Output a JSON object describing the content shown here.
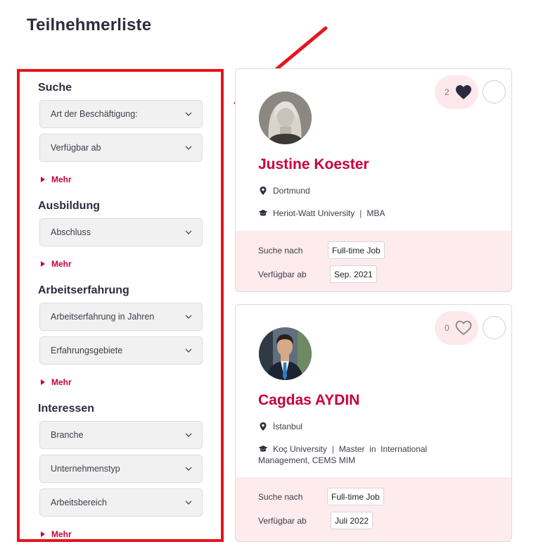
{
  "page": {
    "title": "Teilnehmerliste"
  },
  "filters": {
    "sections": [
      {
        "title": "Suche",
        "selects": [
          "Art der Beschäftigung:",
          "Verfügbar ab"
        ],
        "more_label": "Mehr"
      },
      {
        "title": "Ausbildung",
        "selects": [
          "Abschluss"
        ],
        "more_label": "Mehr"
      },
      {
        "title": "Arbeitserfahrung",
        "selects": [
          "Arbeitserfahrung in Jahren",
          "Erfahrungsgebiete"
        ],
        "more_label": "Mehr"
      },
      {
        "title": "Interessen",
        "selects": [
          "Branche",
          "Unternehmenstyp",
          "Arbeitsbereich"
        ],
        "more_label": "Mehr"
      }
    ]
  },
  "participants": [
    {
      "name": "Justine Koester",
      "location": "Dortmund",
      "university": "Heriot-Watt University",
      "degree": "MBA",
      "likes": "2",
      "liked": true,
      "looking_for_label": "Suche nach",
      "looking_for": "Full-time Job",
      "available_label": "Verfügbar ab",
      "available": "Sep. 2021"
    },
    {
      "name": "Cagdas AYDIN",
      "location": "İstanbul",
      "university": "Koç University",
      "degree_line1": "Master  in  International",
      "degree_line2": "Management, CEMS MIM",
      "likes": "0",
      "liked": false,
      "looking_for_label": "Suche nach",
      "looking_for": "Full-time Job",
      "available_label": "Verfügbar ab",
      "available": "Juli 2022"
    }
  ],
  "colors": {
    "brand": "#c8003c",
    "highlight_border": "#e6141e",
    "pink_bg": "#fdebee",
    "heart_filled": "#2a2a3f"
  }
}
